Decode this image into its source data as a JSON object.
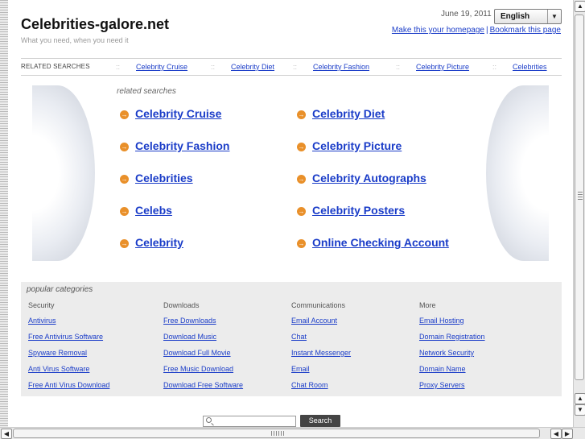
{
  "header": {
    "site_title": "Celebrities-galore.net",
    "tagline": "What you need, when you need it",
    "date": "June 19, 2011",
    "language": "English",
    "homepage_link": "Make this your homepage",
    "separator": "|",
    "bookmark_link": "Bookmark this page"
  },
  "related_bar": {
    "label": "RELATED SEARCHES",
    "separator": "::",
    "items": [
      "Celebrity Cruise",
      "Celebrity Diet",
      "Celebrity Fashion",
      "Celebrity Picture",
      "Celebrities"
    ]
  },
  "related_searches": {
    "label": "related searches",
    "left": [
      "Celebrity Cruise",
      "Celebrity Fashion",
      "Celebrities",
      "Celebs",
      "Celebrity"
    ],
    "right": [
      "Celebrity Diet",
      "Celebrity Picture",
      "Celebrity Autographs",
      "Celebrity Posters",
      "Online Checking Account"
    ]
  },
  "popular": {
    "title": "popular categories",
    "columns": [
      {
        "header": "Security",
        "links": [
          "Antivirus",
          "Free Antivirus Software",
          "Spyware Removal",
          "Anti Virus Software",
          "Free Anti Virus Download"
        ]
      },
      {
        "header": "Downloads",
        "links": [
          "Free Downloads",
          "Download Music",
          "Download Full Movie",
          "Free Music Download",
          "Download Free Software"
        ]
      },
      {
        "header": "Communications",
        "links": [
          "Email Account",
          "Chat",
          "Instant Messenger",
          "Email",
          "Chat Room"
        ]
      },
      {
        "header": "More",
        "links": [
          "Email Hosting",
          "Domain Registration",
          "Network Security",
          "Domain Name",
          "Proxy Servers"
        ]
      }
    ]
  },
  "search": {
    "button_label": "Search",
    "input_value": ""
  },
  "icons": {
    "arrow": "→",
    "scroll_up": "▲",
    "scroll_down": "▼",
    "scroll_left": "◀",
    "scroll_right": "▶",
    "dropdown": "▼"
  },
  "colors": {
    "link": "#1a3cc8",
    "arrow_icon": "#e9902a",
    "popular_bg": "#ececec"
  }
}
